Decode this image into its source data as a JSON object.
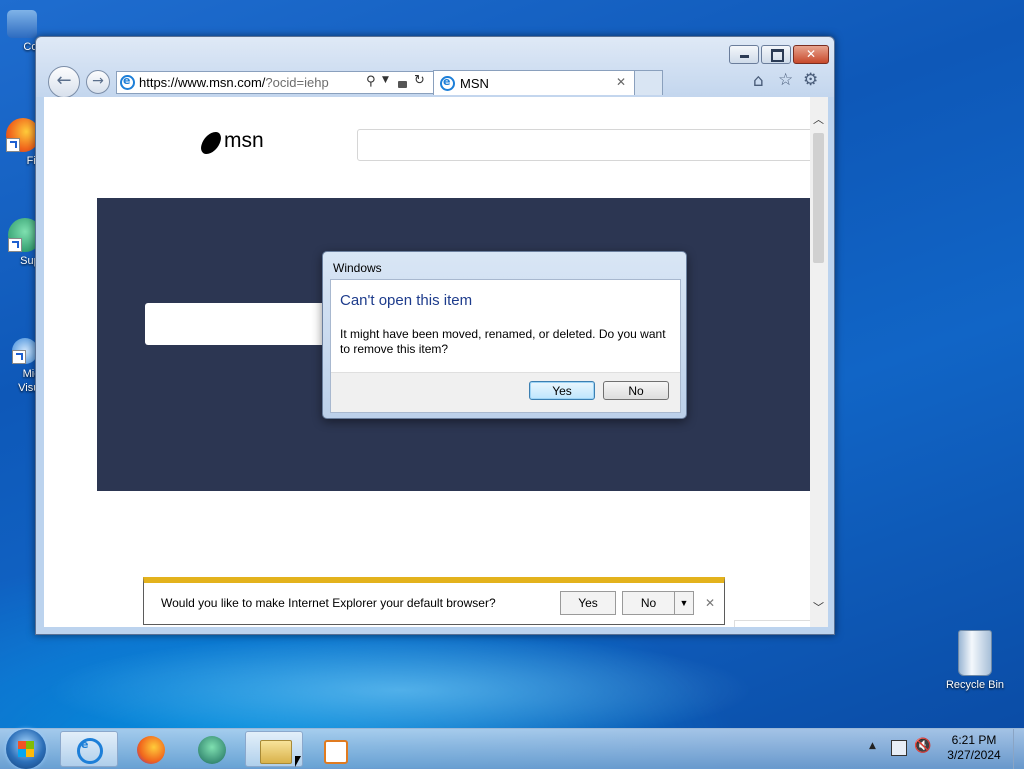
{
  "desktop": {
    "icons": [
      {
        "label": "Com"
      },
      {
        "label": "Fir"
      },
      {
        "label": "Supe"
      },
      {
        "label": "Micr\nVisual"
      },
      {
        "label": "Recycle Bin"
      }
    ]
  },
  "browser": {
    "address": {
      "host": "https://www.msn.com/",
      "path": "?ocid=iehp"
    },
    "tab": {
      "title": "MSN"
    },
    "page": {
      "logo_text": "msn"
    }
  },
  "dialog": {
    "title": "Windows",
    "heading": "Can't open this item",
    "message": "It might have been moved, renamed, or deleted. Do you want to remove this item?",
    "yes_label": "Yes",
    "no_label": "No"
  },
  "notification": {
    "message": "Would you like to make Internet Explorer your default browser?",
    "yes_label": "Yes",
    "no_label": "No"
  },
  "taskbar": {
    "time": "6:21 PM",
    "date": "3/27/2024"
  },
  "colors": {
    "msn_panel": "#2c3652",
    "dialog_heading": "#1e3c8c",
    "notification_accent": "#e3b21d"
  }
}
